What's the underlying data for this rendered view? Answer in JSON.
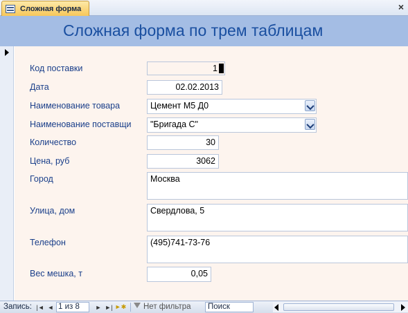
{
  "tab": {
    "label": "Сложная форма",
    "close": "×"
  },
  "form": {
    "title": "Сложная форма по трем таблицам"
  },
  "fields": {
    "supply_code": {
      "label": "Код поставки",
      "value": "1"
    },
    "date": {
      "label": "Дата",
      "value": "02.02.2013"
    },
    "product_name": {
      "label": "Наименование товара",
      "value": "Цемент М5 Д0"
    },
    "supplier_name": {
      "label": "Наименование поставщи",
      "value": "\"Бригада С\""
    },
    "quantity": {
      "label": "Количество",
      "value": "30"
    },
    "price": {
      "label": "Цена, руб",
      "value": "3062"
    },
    "city": {
      "label": "Город",
      "value": "Москва"
    },
    "street": {
      "label": "Улица, дом",
      "value": "Свердлова, 5"
    },
    "phone": {
      "label": "Телефон",
      "value": "(495)741-73-76"
    },
    "bag_weight": {
      "label": "Вес мешка, т",
      "value": "0,05"
    }
  },
  "navigation": {
    "record_label": "Запись:",
    "record_position": "1 из 8",
    "filter_label": "Нет фильтра",
    "search_placeholder": "Поиск"
  },
  "colors": {
    "header_bg": "#a4bde4",
    "title": "#1a4fa0",
    "label": "#1a3f8a",
    "detail_bg": "#fdf4ee"
  }
}
